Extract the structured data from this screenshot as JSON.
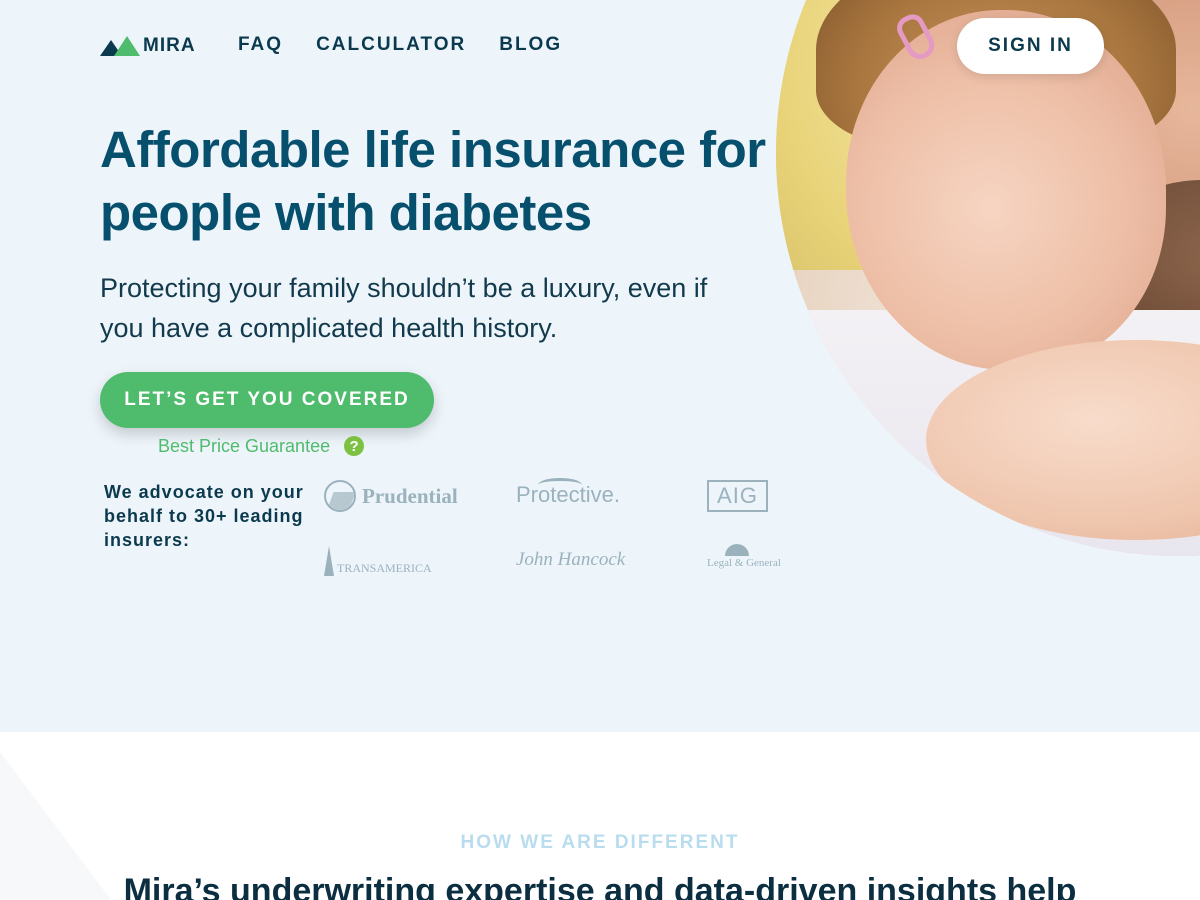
{
  "brand": {
    "name": "MIRA",
    "colors": {
      "primary": "#064f6d",
      "accent": "#4fbb6c",
      "hero_bg": "#edf5fb"
    }
  },
  "nav": {
    "items": [
      {
        "label": "FAQ"
      },
      {
        "label": "CALCULATOR"
      },
      {
        "label": "BLOG"
      }
    ],
    "signin_label": "SIGN IN"
  },
  "hero": {
    "title": "Affordable life insurance for people with diabetes",
    "lead": "Protecting your family shouldn’t be a luxury, even if you have a complicated health history.",
    "cta_label": "LET’S GET YOU COVERED",
    "guarantee_label": "Best Price Guarantee",
    "guarantee_help_icon": "?",
    "advocate_text": "We advocate on your behalf to 30+ leading insurers:",
    "insurers": [
      {
        "name": "Prudential"
      },
      {
        "name": "Protective."
      },
      {
        "name": "AIG"
      },
      {
        "name": "TRANSAMERICA"
      },
      {
        "name": "John Hancock"
      },
      {
        "name": "Legal & General"
      }
    ]
  },
  "different": {
    "label": "HOW WE ARE DIFFERENT",
    "title": "Mira’s underwriting expertise and data-driven insights help"
  }
}
